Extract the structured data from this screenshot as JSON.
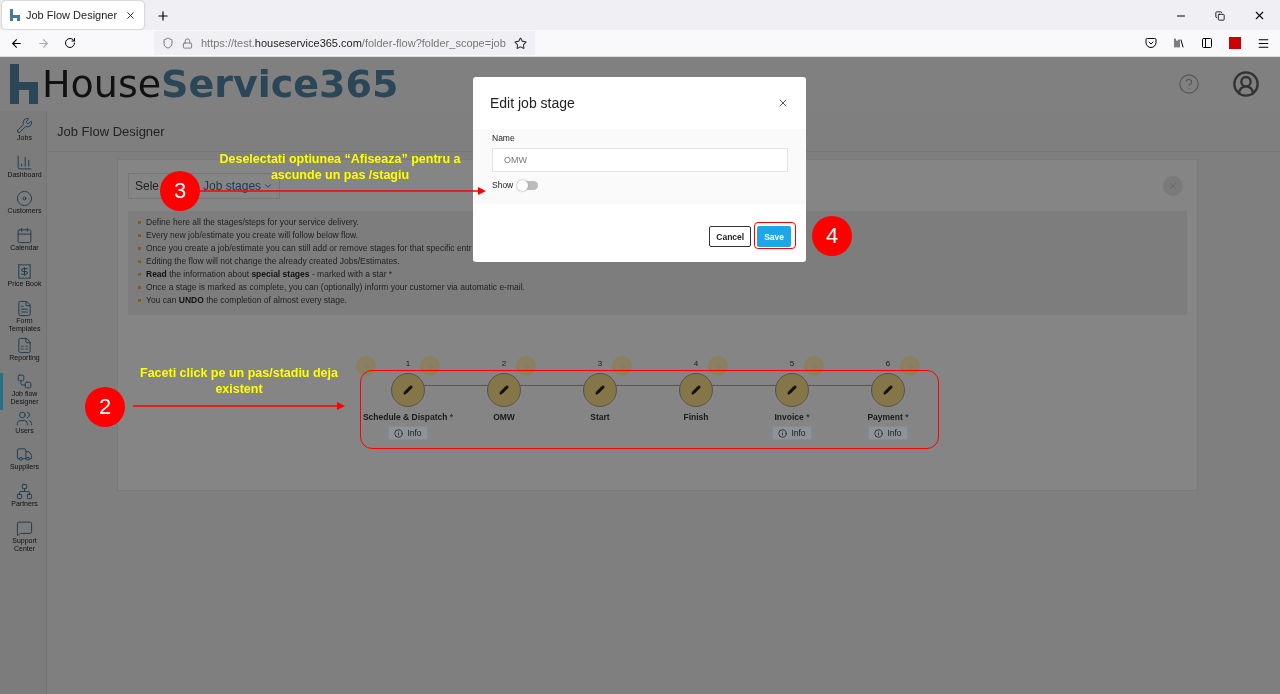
{
  "browser": {
    "tab_title": "Job Flow Designer",
    "url": "https://test.**houseservice365.com**/folder-flow?folder_scope=job"
  },
  "header": {
    "logo_first": "House",
    "logo_second": "Service365"
  },
  "sidebar": {
    "items": [
      {
        "label": "Jobs",
        "selected": false
      },
      {
        "label": "Dashboard",
        "selected": false
      },
      {
        "label": "Customers",
        "selected": false
      },
      {
        "label": "Calendar",
        "selected": false
      },
      {
        "label": "Price Book",
        "selected": false
      },
      {
        "label": "Form Templates",
        "selected": false
      },
      {
        "label": "Reporting",
        "selected": false
      },
      {
        "label": "Job flow Designer",
        "selected": true
      },
      {
        "label": "Users",
        "selected": false
      },
      {
        "label": "Suppliers",
        "selected": false
      },
      {
        "label": "Partners",
        "selected": false
      },
      {
        "label": "Support Center",
        "selected": false
      }
    ]
  },
  "page_title": "Job Flow Designer",
  "selector": {
    "label": "Sele",
    "value": "Job stages"
  },
  "info": [
    "Define here all the stages/steps for your service delivery.",
    "Every new job/estimate you create will follow below flow.",
    "Once you create a job/estimate you can still add or remove stages for that specific entr",
    "Editing the flow will not change the already created Jobs/Estimates.",
    "**Read** the information about **special stages** - marked with a star *",
    "Once a stage is marked as complete, you can (optionally) inform your customer via automatic e-mail.",
    "You can **UNDO** the completion of almost every stage."
  ],
  "stages": [
    {
      "number": "1",
      "name": "Schedule & Dispatch",
      "star": "*",
      "info": "Info"
    },
    {
      "number": "2",
      "name": "OMW"
    },
    {
      "number": "3",
      "name": "Start"
    },
    {
      "number": "4",
      "name": "Finish"
    },
    {
      "number": "5",
      "name": "Invoice",
      "star": "*",
      "info": "Info"
    },
    {
      "number": "6",
      "name": "Payment",
      "star": "*",
      "info": "Info"
    }
  ],
  "modal": {
    "title": "Edit job stage",
    "name_label": "Name",
    "name_value": "OMW",
    "show": {
      "label": "Show",
      "on": false
    },
    "buttons": [
      "Cancel",
      "Save"
    ]
  },
  "annotations": [
    {
      "number": "3",
      "text": "Deselectati optiunea “Afiseaza” pentru a ascunde un pas /stagiu"
    },
    {
      "number": "2",
      "text": "Faceti click pe un pas/stadiu deja existent"
    },
    {
      "number": "4"
    }
  ]
}
